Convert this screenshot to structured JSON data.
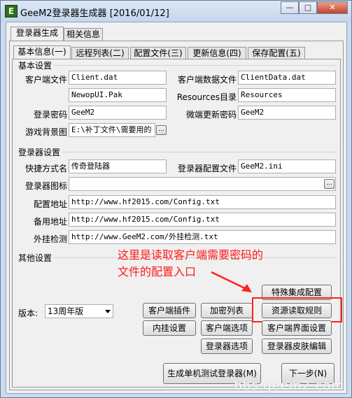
{
  "window": {
    "title": "GeeM2登录器生成器 [2016/01/12]",
    "icon_letter": "E",
    "controls": {
      "minimize": "—",
      "maximize": "□",
      "close": "✕"
    }
  },
  "top_tabs": [
    {
      "label": "登录器生成",
      "active": true
    },
    {
      "label": "相关信息",
      "active": false
    }
  ],
  "inner_tabs": [
    {
      "label": "基本信息(一)",
      "active": true
    },
    {
      "label": "远程列表(二)",
      "active": false
    },
    {
      "label": "配置文件(三)",
      "active": false
    },
    {
      "label": "更新信息(四)",
      "active": false
    },
    {
      "label": "保存配置(五)",
      "active": false
    }
  ],
  "basic": {
    "title": "基本设置",
    "client_file_label": "客户端文件",
    "client_file_value": "Client.dat",
    "client_data_label": "客户端数据文件",
    "client_data_value": "ClientData.dat",
    "newpop_value": "NewopUI.Pak",
    "resources_label": "Resources目录",
    "resources_value": "Resources",
    "login_pwd_label": "登录密码",
    "login_pwd_value": "GeeM2",
    "update_pwd_label": "微端更新密码",
    "update_pwd_value": "GeeM2",
    "bg_label": "游戏背景图",
    "bg_value": "E:\\补丁文件\\需要用的",
    "browse_label": "..."
  },
  "launcher": {
    "title": "登录器设置",
    "shortcut_label": "快捷方式名",
    "shortcut_value": "传奇登陆器",
    "config_file_label": "登录器配置文件",
    "config_file_value": "GeeM2.ini",
    "icon_label": "登录器图标",
    "icon_value": "",
    "browse_label": "...",
    "config_url_label": "配置地址",
    "config_url_value": "http://www.hf2015.com/Config.txt",
    "backup_url_label": "备用地址",
    "backup_url_value": "http://www.hf2015.com/Config.txt",
    "plugin_check_label": "外挂检测",
    "plugin_check_value": "http://www.GeeM2.com/外挂检测.txt"
  },
  "other": {
    "title": "其他设置",
    "annotation_line1": "这里是读取客户端需要密码的",
    "annotation_line2": "文件的配置入口",
    "version_label": "版本:",
    "version_value": "13周年版",
    "buttons": {
      "special": "特殊集成配置",
      "client_plugin": "客户端插件",
      "encrypt_list": "加密列表",
      "resource_rules": "资源读取规则",
      "inner_hang": "内挂设置",
      "client_options": "客户端选项",
      "client_ui": "客户端界面设置",
      "login_options": "登录器选项",
      "login_skin": "登录器皮肤编辑"
    }
  },
  "footer": {
    "generate": "生成单机测试登录器(M)",
    "next": "下一步(N)"
  },
  "watermark": "bbs.geem2.com"
}
